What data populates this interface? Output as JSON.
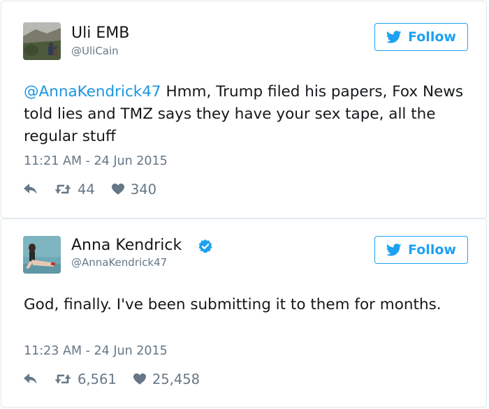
{
  "colors": {
    "accent": "#1da1f2",
    "mention": "#1b95e0",
    "secondary_text": "#657786",
    "border": "#e1e8ed"
  },
  "tweets": [
    {
      "user_name": "Uli EMB",
      "user_handle": "@UliCain",
      "verified": false,
      "follow_label": "Follow",
      "mention": "@AnnaKendrick47",
      "text": " Hmm, Trump filed his papers, Fox News told lies and TMZ says they have your sex tape, all the regular stuff",
      "timestamp": "11:21 AM - 24 Jun 2015",
      "retweets": "44",
      "likes": "340",
      "icons": [
        "reply-icon",
        "retweet-icon",
        "heart-icon",
        "twitter-bird-icon"
      ]
    },
    {
      "user_name": "Anna Kendrick",
      "user_handle": "@AnnaKendrick47",
      "verified": true,
      "follow_label": "Follow",
      "text": "God, finally. I've been submitting it to them for months.",
      "timestamp": "11:23 AM - 24 Jun 2015",
      "retweets": "6,561",
      "likes": "25,458",
      "icons": [
        "reply-icon",
        "retweet-icon",
        "heart-icon",
        "twitter-bird-icon",
        "verified-badge-icon"
      ]
    }
  ]
}
